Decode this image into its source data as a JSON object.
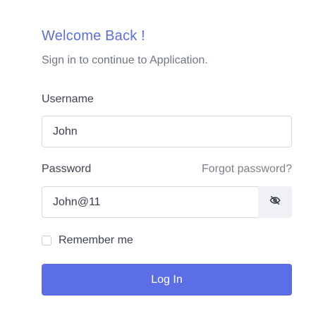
{
  "header": {
    "title": "Welcome Back !",
    "subtitle": "Sign in to continue to Application."
  },
  "form": {
    "username_label": "Username",
    "username_value": "John",
    "password_label": "Password",
    "forgot_link": "Forgot password?",
    "password_value": "John@11",
    "password_toggle_icon": "eye-off-icon",
    "remember_label": "Remember me",
    "remember_checked": false,
    "login_label": "Log In"
  },
  "colors": {
    "accent": "#5b6ee5",
    "title": "#5b6ee0"
  }
}
